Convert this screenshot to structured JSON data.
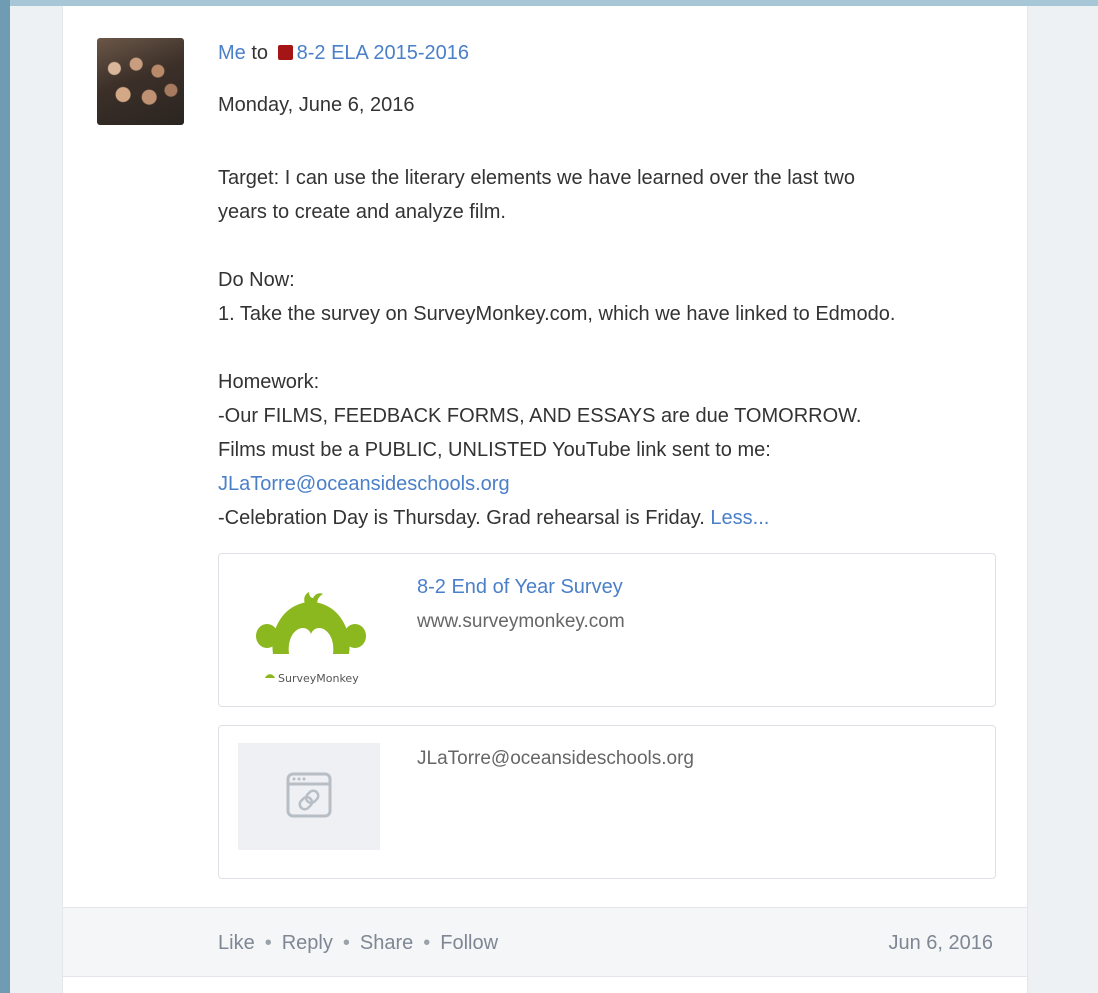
{
  "post": {
    "author": "Me",
    "to_word": "to",
    "group_name": "8-2 ELA 2015-2016",
    "group_color": "#a51515",
    "date_heading": "Monday, June 6, 2016",
    "body": {
      "target_line1": "Target: I can use the literary elements we have learned over the last two",
      "target_line2": "years to create and analyze film.",
      "do_now_heading": "Do Now:",
      "do_now_item1": "1. Take the survey on SurveyMonkey.com, which we have linked to Edmodo.",
      "homework_heading": "Homework:",
      "homework_line1": "-Our FILMS, FEEDBACK FORMS, AND ESSAYS are due TOMORROW.",
      "homework_line2": "Films must be a PUBLIC, UNLISTED YouTube link sent to me:",
      "email_link": "JLaTorre@oceansideschools.org",
      "homework_line3": "-Celebration Day is Thursday. Grad rehearsal is Friday.",
      "less_link": "Less..."
    },
    "attachments": [
      {
        "title": "8-2 End of Year Survey",
        "url": "www.surveymonkey.com",
        "logo_text": "SurveyMonkey",
        "icon": "surveymonkey-logo"
      },
      {
        "title": "JLaTorre@oceansideschools.org",
        "icon": "link-page-icon"
      }
    ],
    "actions": [
      "Like",
      "Reply",
      "Share",
      "Follow"
    ],
    "separator": "•",
    "timestamp": "Jun 6, 2016"
  },
  "colors": {
    "link": "#4a7fc9",
    "text": "#333333",
    "muted": "#7e8793",
    "logo_green": "#8bb81e"
  }
}
